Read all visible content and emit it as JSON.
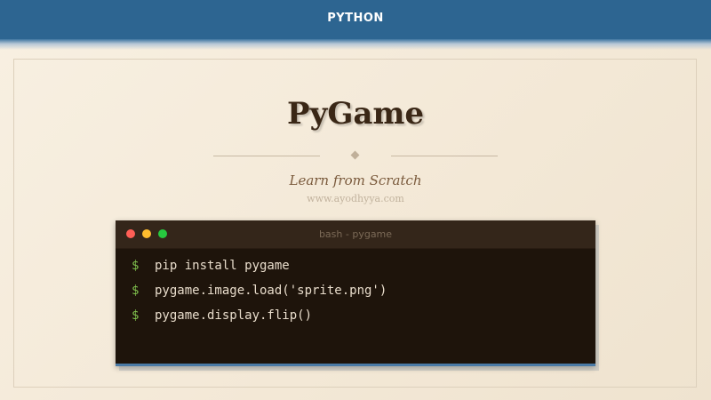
{
  "header": {
    "label": "PYTHON",
    "color": "#2d6591"
  },
  "main": {
    "title": "PyGame",
    "subtitle": "Learn from Scratch",
    "website": "www.ayodhyya.com"
  },
  "terminal": {
    "title": "bash - pygame",
    "prompt": "$",
    "lines": [
      "pip install pygame",
      "pygame.image.load('sprite.png')",
      "pygame.display.flip()"
    ],
    "window_controls": [
      "close-dot-red",
      "minimize-dot-yellow",
      "maximize-dot-green"
    ],
    "prompt_color": "#7fbf4d"
  }
}
